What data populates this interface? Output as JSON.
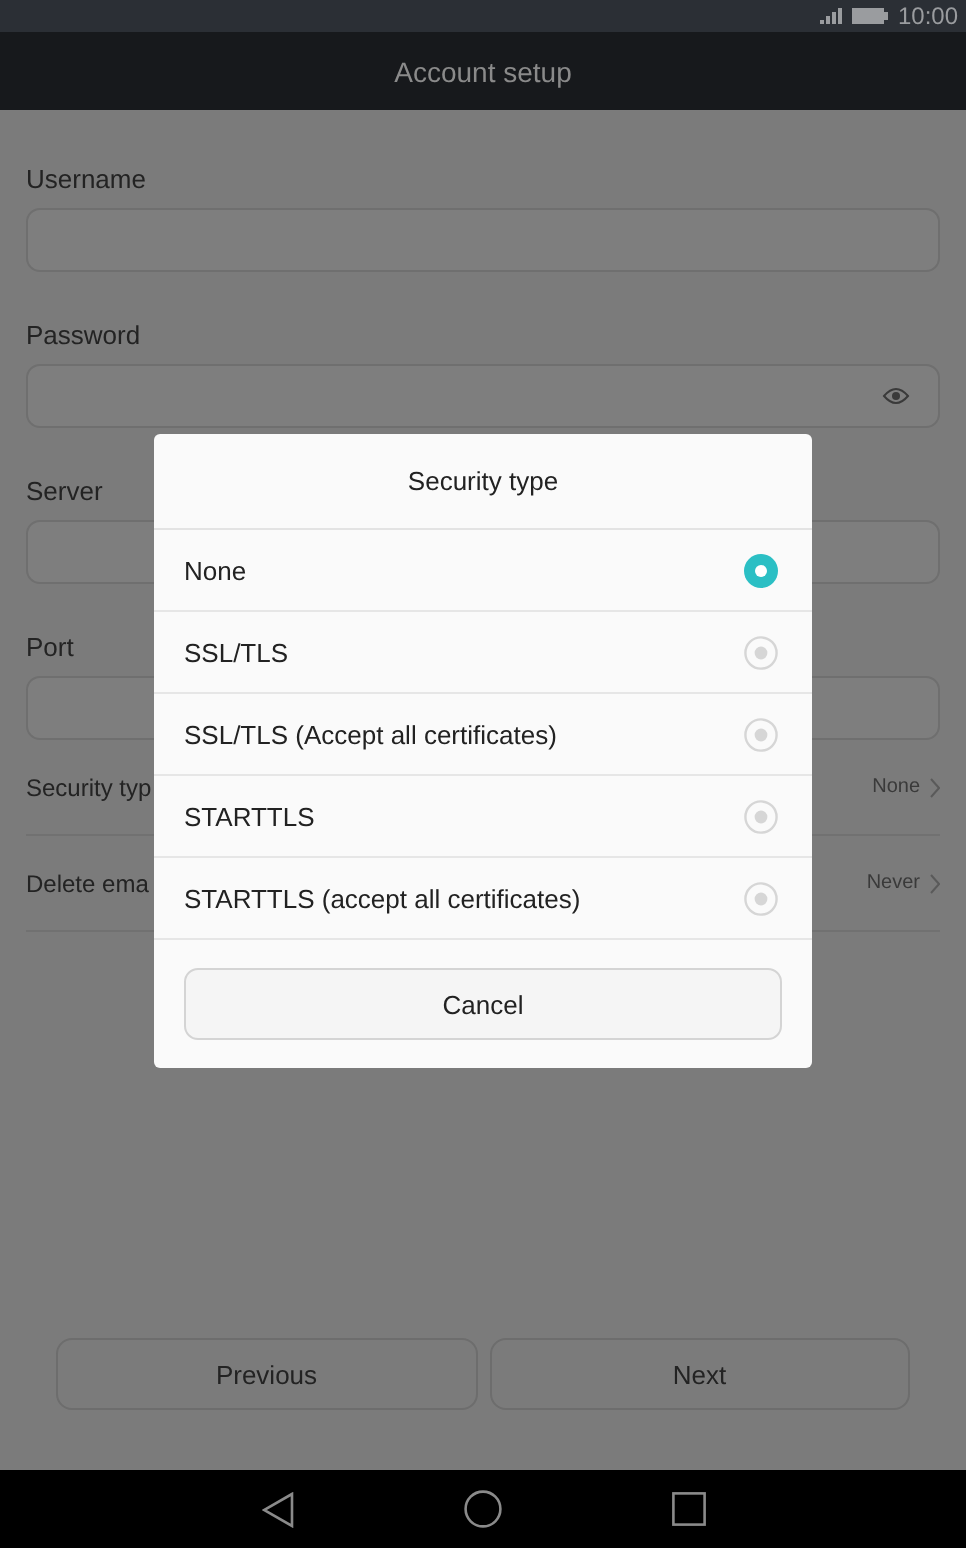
{
  "status_bar": {
    "time": "10:00"
  },
  "toolbar": {
    "title": "Account setup"
  },
  "fields": [
    {
      "label": "Username",
      "kind": "text"
    },
    {
      "label": "Password",
      "kind": "password"
    },
    {
      "label": "Server",
      "kind": "text"
    },
    {
      "label": "Port",
      "kind": "text"
    }
  ],
  "settings": [
    {
      "label": "Security typ",
      "value": "None"
    },
    {
      "label": "Delete ema",
      "value": "Never"
    }
  ],
  "buttons": [
    "Previous",
    "Next"
  ],
  "dialog": {
    "title": "Security type",
    "options": [
      {
        "label": "None",
        "selected": true
      },
      {
        "label": "SSL/TLS",
        "selected": false
      },
      {
        "label": "SSL/TLS (Accept all certificates)",
        "selected": false
      },
      {
        "label": "STARTTLS",
        "selected": false
      },
      {
        "label": "STARTTLS (accept all certificates)",
        "selected": false
      }
    ],
    "cancel": "Cancel"
  }
}
